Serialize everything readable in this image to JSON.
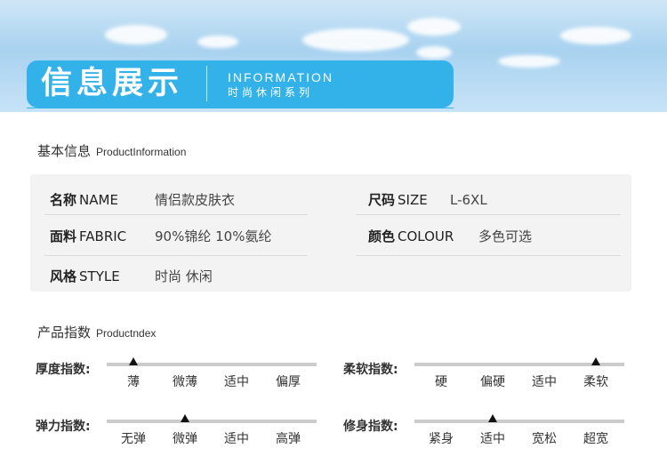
{
  "banner": {
    "title_zh": "信息展示",
    "title_en": "INFORMATION",
    "subtitle": "时尚休闲系列"
  },
  "basic_info": {
    "heading": "基本信息",
    "heading_en": "ProductInformation",
    "fields": {
      "name": {
        "label": "名称",
        "label_en": "NAME",
        "value": "情侣款皮肤衣"
      },
      "size": {
        "label": "尺码",
        "label_en": "SIZE",
        "value": "L-6XL"
      },
      "fabric": {
        "label": "面料",
        "label_en": "FABRIC",
        "value": "90%锦纶 10%氨纶"
      },
      "colour": {
        "label": "颜色",
        "label_en": "COLOUR",
        "value": "多色可选"
      },
      "style": {
        "label": "风格",
        "label_en": "STYLE",
        "value": "时尚 休闲"
      }
    }
  },
  "product_index": {
    "heading": "产品指数",
    "heading_en": "Productndex",
    "thickness": {
      "label": "厚度指数:",
      "options": [
        "薄",
        "微薄",
        "适中",
        "偏厚"
      ],
      "selected": 0
    },
    "softness": {
      "label": "柔软指数:",
      "options": [
        "硬",
        "偏硬",
        "适中",
        "柔软"
      ],
      "selected": 3
    },
    "elasticity": {
      "label": "弹力指数:",
      "options": [
        "无弹",
        "微弹",
        "适中",
        "高弹"
      ],
      "selected": 1
    },
    "fit": {
      "label": "修身指数:",
      "options": [
        "紧身",
        "适中",
        "宽松",
        "超宽"
      ],
      "selected": 1
    }
  },
  "colors": {
    "accent": "#33b2ea",
    "card_bg": "#f3f3f3",
    "track": "#cccccc",
    "marker": "#111111"
  }
}
